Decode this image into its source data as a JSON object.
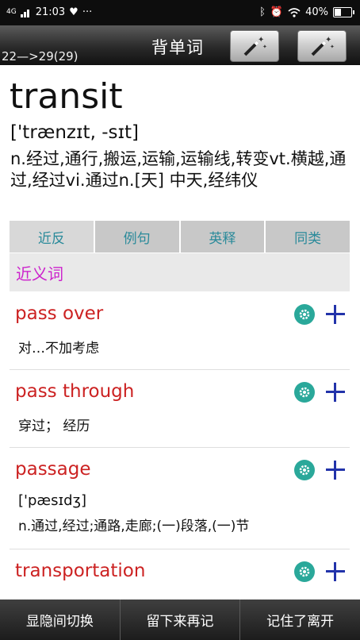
{
  "status": {
    "network": "4G",
    "time": "21:03",
    "heart": "♥",
    "more": "···",
    "battery": "40%"
  },
  "header": {
    "title": "背单词",
    "progress": "22—>29(29)"
  },
  "word": {
    "headword": "transit",
    "phonetic": "['trænzɪt, -sɪt]",
    "meaning": "n.经过,通行,搬运,运输,运输线,转变vt.横越,通过,经过vi.通过n.[天] 中天,经纬仪"
  },
  "tabs": [
    "近反",
    "例句",
    "英释",
    "同类"
  ],
  "section": {
    "title": "近义词"
  },
  "items": [
    {
      "word": "pass over",
      "desc": "对…不加考虑"
    },
    {
      "word": "pass through",
      "desc": "穿过； 经历"
    },
    {
      "word": "passage",
      "phonetic": "['pæsɪdʒ]",
      "desc": "n.通过,经过;通路,走廊;(一)段落,(一)节"
    },
    {
      "word": "transportation"
    }
  ],
  "bottom": {
    "toggle": "显隐间切换",
    "keep": "留下来再记",
    "done": "记住了离开"
  },
  "colors": {
    "tab_text": "#2a8a9a",
    "section_title": "#cc22cc",
    "word_red": "#cc2222",
    "gear": "#2aa89a",
    "plus": "#2233aa"
  }
}
